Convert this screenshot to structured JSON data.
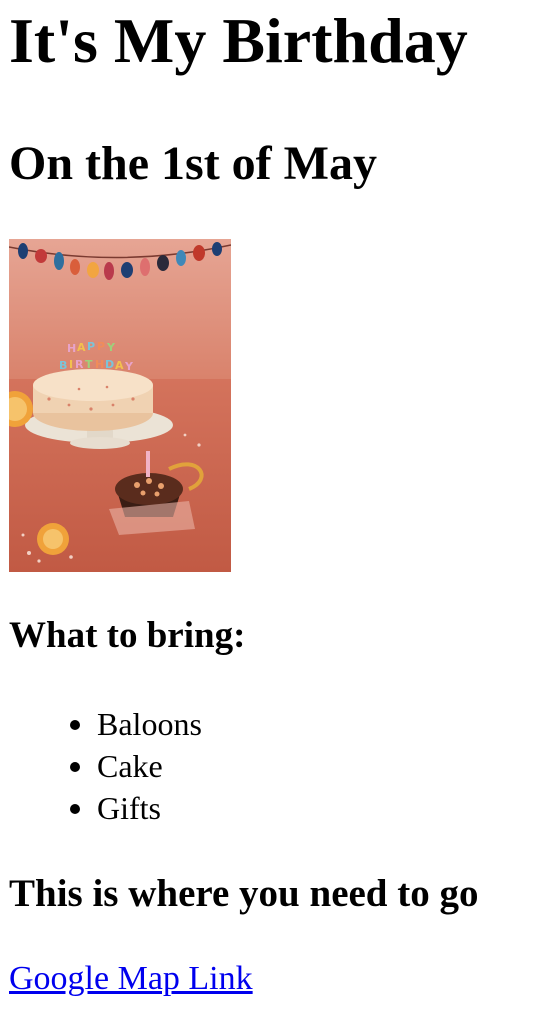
{
  "page": {
    "title": "It's My Birthday",
    "subtitle": "On the 1st of May"
  },
  "photo": {
    "icon": "birthday-cake-photo",
    "description_text": "HAPPY BIRTHDAY",
    "colors": {
      "background": "#cf7660",
      "wall": "#d88a72",
      "cake": "#f1d3b4",
      "plate": "#ece6dc",
      "cupcake": "#4a2418"
    }
  },
  "bring": {
    "heading": "What to bring:",
    "items": [
      "Baloons",
      "Cake",
      "Gifts"
    ]
  },
  "directions": {
    "heading": "This is where you need to go",
    "link_label": "Google Map Link",
    "link_color": "#0000ee"
  }
}
